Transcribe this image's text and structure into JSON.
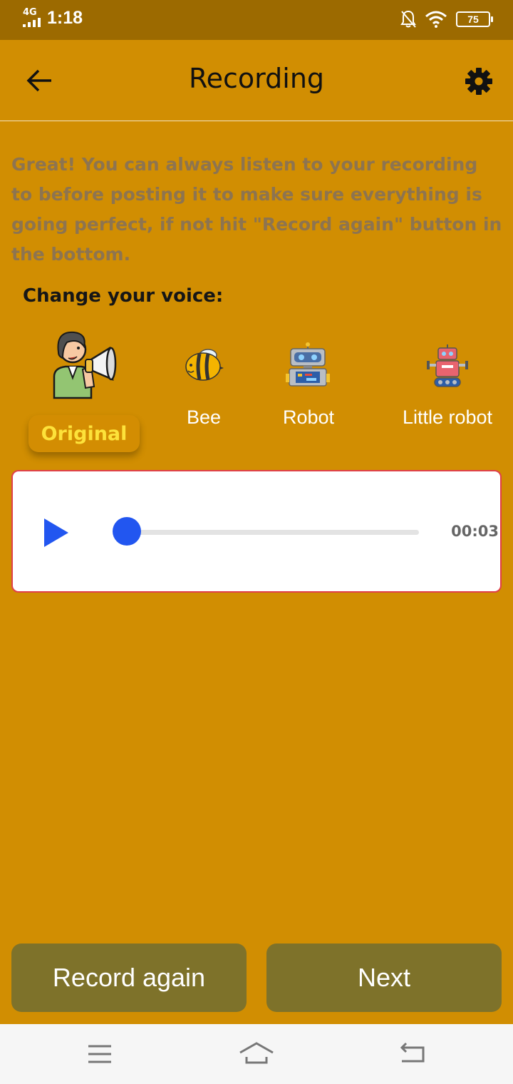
{
  "status_bar": {
    "network": "4G",
    "time": "1:18",
    "battery": "75"
  },
  "app_bar": {
    "title": "Recording"
  },
  "description": "Great! You can always listen to your recording to before posting it to make sure everything is going perfect, if not hit \"Record again\" button in the bottom.",
  "voice_section": {
    "heading": "Change your voice:",
    "options": [
      {
        "label": "Original",
        "icon": "megaphone-person-icon",
        "selected": true
      },
      {
        "label": "Bee",
        "icon": "bee-icon",
        "selected": false
      },
      {
        "label": "Robot",
        "icon": "robot-icon",
        "selected": false
      },
      {
        "label": "Little robot",
        "icon": "little-robot-icon",
        "selected": false
      }
    ]
  },
  "player": {
    "duration": "00:03",
    "progress": 0,
    "colors": {
      "accent": "#2256f0",
      "border": "#e0404a"
    }
  },
  "buttons": {
    "record_again": "Record again",
    "next": "Next"
  },
  "colors": {
    "background": "#d18e02",
    "status_bar": "#9c6a00",
    "button": "#7e722a",
    "selected_label": "#fde23a"
  }
}
